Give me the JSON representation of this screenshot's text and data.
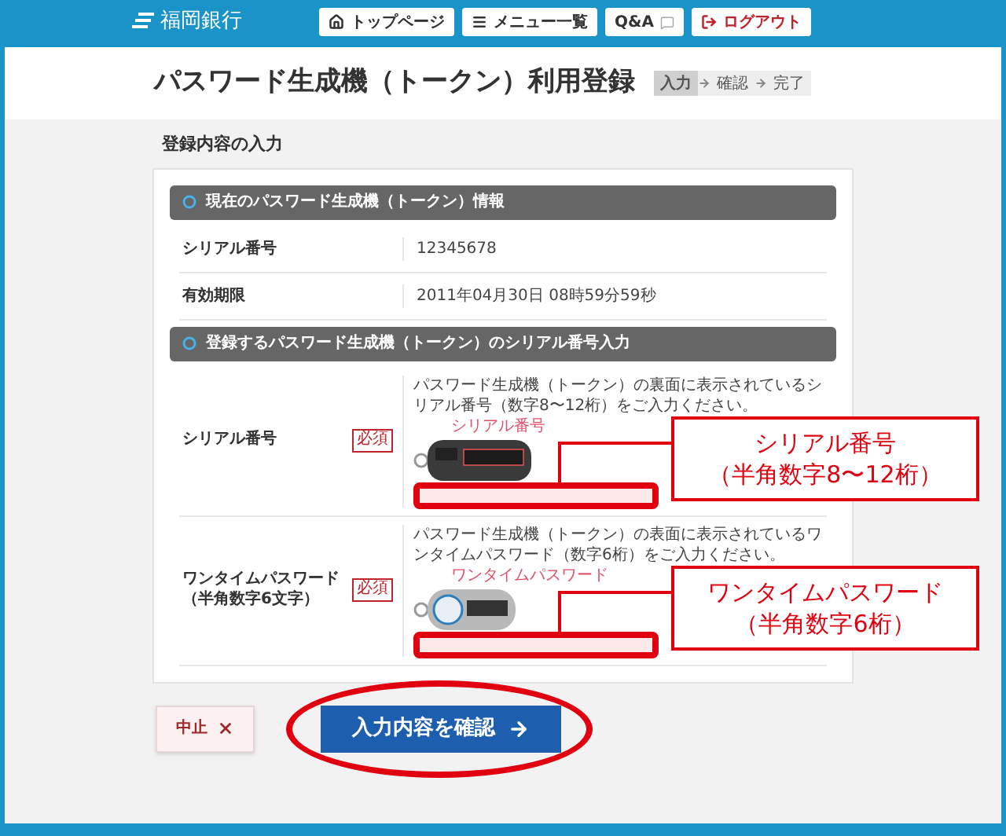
{
  "header": {
    "logo": "福岡銀行",
    "nav": [
      {
        "kind": "home",
        "label": "トップページ"
      },
      {
        "kind": "menu",
        "label": "メニュー一覧"
      },
      {
        "kind": "qa",
        "label": "Q&A"
      },
      {
        "kind": "logout",
        "label": "ログアウト"
      }
    ]
  },
  "title": "パスワード生成機（トークン）利用登録",
  "steps": [
    {
      "label": "入力",
      "selected": true
    },
    {
      "label": "確認",
      "selected": false
    },
    {
      "label": "完了",
      "selected": false
    }
  ],
  "section_title": "登録内容の入力",
  "groups": [
    {
      "heading": "現在のパスワード生成機（トークン）情報",
      "rows": [
        {
          "kind": "info",
          "label": "シリアル番号",
          "value": "12345678"
        },
        {
          "kind": "info",
          "label": "有効期限",
          "value": "2011年04月30日 08時59分59秒"
        }
      ]
    },
    {
      "heading": "登録するパスワード生成機（トークン）のシリアル番号入力",
      "rows": [
        {
          "kind": "input",
          "label": "シリアル番号",
          "required": "必須",
          "description": "パスワード生成機（トークン）の裏面に表示されているシリアル番号（数字8〜12桁）をご入力ください。",
          "token": {
            "kind": "back",
            "label": "シリアル番号"
          },
          "annotated": true,
          "callout": [
            "シリアル番号",
            "（半角数字8〜12桁）"
          ]
        },
        {
          "kind": "input",
          "label": "ワンタイムパスワード",
          "sublabel": "（半角数字6文字）",
          "required": "必須",
          "description": "パスワード生成機（トークン）の表面に表示されているワンタイムパスワード（数字6桁）をご入力ください。",
          "token": {
            "kind": "front",
            "label": "ワンタイムパスワード"
          },
          "annotated": true,
          "callout": [
            "ワンタイムパスワード",
            "（半角数字6桁）"
          ]
        }
      ]
    }
  ],
  "buttons": {
    "cancel": "中止",
    "confirm": "入力内容を確認",
    "confirm_annotated": true
  }
}
